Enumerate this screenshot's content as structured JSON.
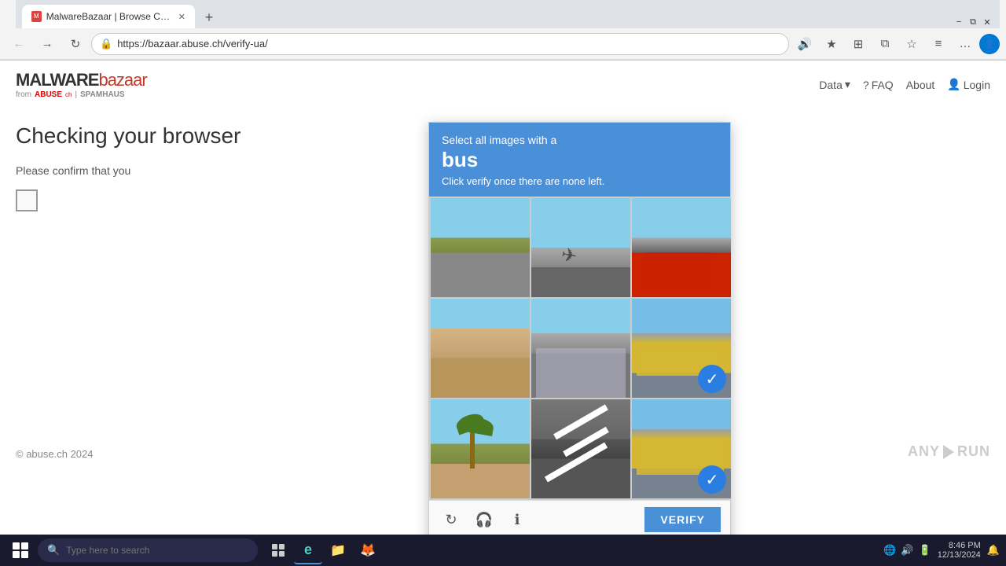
{
  "browser": {
    "title_bar": {
      "minimize_label": "−",
      "restore_label": "⧉",
      "close_label": "✕"
    },
    "tabs": [
      {
        "id": "tab1",
        "label": "MalwareBazaar | Browse Checkin...",
        "favicon": "M",
        "active": true
      }
    ],
    "new_tab_label": "+",
    "address_bar": {
      "url": "https://bazaar.abuse.ch/verify-ua/",
      "read_icon": "🔒"
    },
    "nav": {
      "back_label": "←",
      "forward_label": "→",
      "refresh_label": "↻",
      "read_aloud_label": "🔊",
      "favorites_label": "★",
      "extensions_label": "⊞",
      "split_label": "⧉",
      "favorites_bar_label": "☆",
      "collections_label": "≡",
      "settings_label": "…"
    }
  },
  "site": {
    "logo": {
      "malware": "MALWARE",
      "bazaar": "bazaar",
      "from_label": "from",
      "abuse_label": "ABUSE",
      "ch_label": "ch",
      "separator": "|",
      "spamhaus_label": "SPAMHAUS"
    },
    "nav_links": [
      {
        "label": "Data",
        "has_arrow": true
      },
      {
        "label": "FAQ",
        "has_icon": true
      },
      {
        "label": "About"
      },
      {
        "label": "Login",
        "has_icon": true
      }
    ]
  },
  "page": {
    "title": "Checking your browser",
    "confirm_text": "Please confirm that you",
    "checkbox_label": "",
    "copyright": "© abuse.ch 2024"
  },
  "captcha": {
    "header": {
      "instruction": "Select all images with a",
      "word": "bus",
      "subtext": "Click verify once there are none left."
    },
    "images": [
      {
        "id": "img1",
        "type": "street1",
        "selected": false,
        "label": "Street scene with trees"
      },
      {
        "id": "img2",
        "type": "airport",
        "selected": false,
        "label": "Airport road"
      },
      {
        "id": "img3",
        "type": "bus-red",
        "selected": false,
        "label": "Red double-decker bus"
      },
      {
        "id": "img4",
        "type": "wall",
        "selected": false,
        "label": "Wall with palm"
      },
      {
        "id": "img5",
        "type": "parking",
        "selected": false,
        "label": "Parking lot building"
      },
      {
        "id": "img6",
        "type": "schoolbus1",
        "selected": true,
        "label": "School bus on road"
      },
      {
        "id": "img7",
        "type": "palm",
        "selected": false,
        "label": "Palm trees"
      },
      {
        "id": "img8",
        "type": "road",
        "selected": false,
        "label": "Road markings"
      },
      {
        "id": "img9",
        "type": "schoolbus2",
        "selected": true,
        "label": "School bus side view"
      }
    ],
    "footer": {
      "refresh_label": "↻",
      "audio_label": "🎧",
      "info_label": "ℹ",
      "verify_label": "VERIFY"
    }
  },
  "anyrun": {
    "label": "ANY RUN"
  },
  "taskbar": {
    "search_placeholder": "Type here to search",
    "apps": [
      {
        "label": "Task View",
        "icon": "⊞"
      },
      {
        "label": "Microsoft Edge",
        "icon": "e",
        "active": true
      },
      {
        "label": "File Explorer",
        "icon": "📁"
      },
      {
        "label": "Firefox",
        "icon": "🦊"
      }
    ],
    "system": {
      "time": "8:46 PM",
      "date": "12/13/2024",
      "battery_label": "🔋",
      "volume_label": "🔊",
      "network_label": "🌐",
      "notification_label": "🔔"
    }
  }
}
